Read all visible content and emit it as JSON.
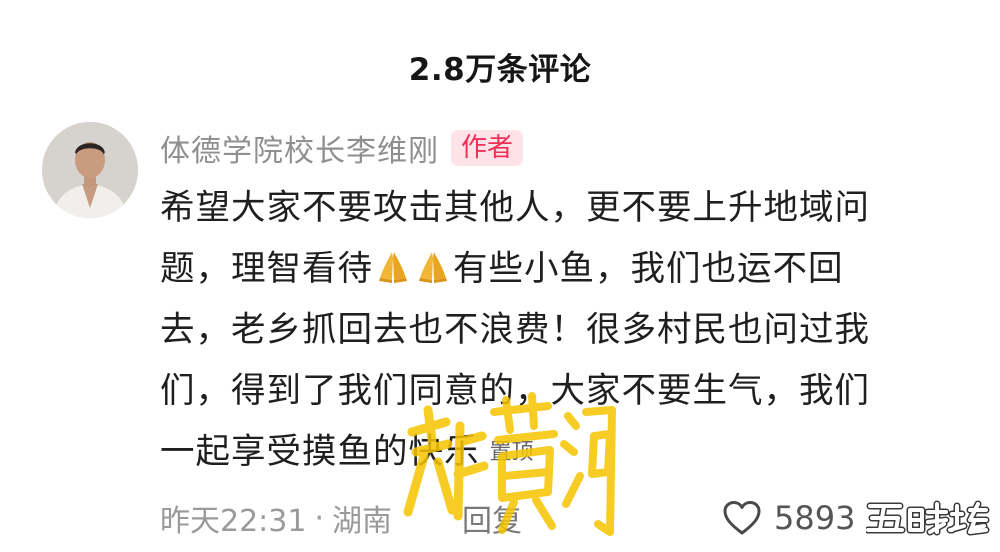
{
  "header": {
    "title": "2.8万条评论"
  },
  "comment": {
    "author": "体德学院校长李维刚",
    "author_badge": "作者",
    "lines": [
      "希望大家不要攻击其他人，更不要上升地域问",
      "题，理智看待",
      "有些小鱼，我们也运不回",
      "去，老乡抓回去也不浪费！很多村民也问过我",
      "们，得到了我们同意的，大家不要生气，我们",
      "一起享受摸鱼的快乐"
    ],
    "emoji": "palms-together-icon",
    "pinned_label": "置顶",
    "time": "昨天22:31",
    "dot": "·",
    "location": "湖南",
    "reply_label": "回复",
    "like_count": "5893"
  },
  "watermarks": {
    "stamp": "新黄河",
    "site": "五味坛"
  },
  "colors": {
    "badge_bg": "#ffe3e8",
    "badge_text": "#ef2f56",
    "muted_text": "#9a9a9a",
    "watermark_yellow": "#f5c400"
  }
}
